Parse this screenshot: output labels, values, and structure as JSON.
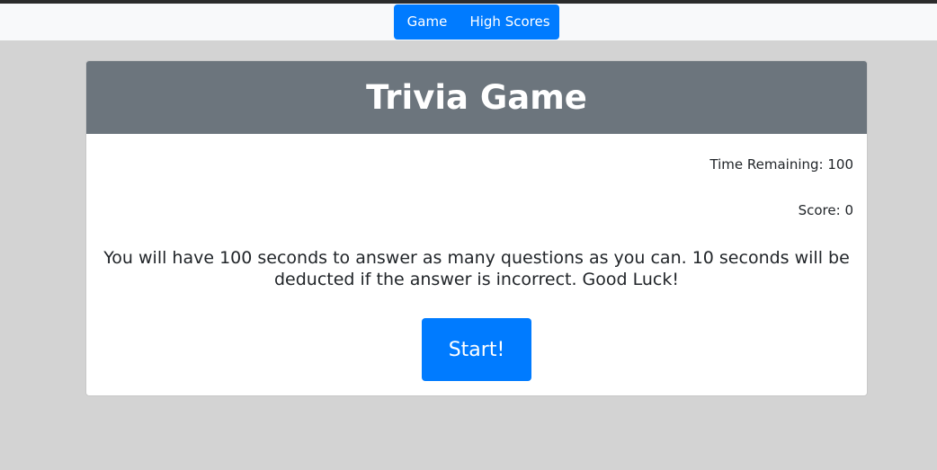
{
  "nav": {
    "game_label": "Game",
    "high_scores_label": "High Scores"
  },
  "card": {
    "title": "Trivia Game",
    "time_remaining": "Time Remaining: 100",
    "score": "Score: 0",
    "instructions": "You will have 100 seconds to answer as many questions as you can. 10 seconds will be deducted if the answer is incorrect. Good Luck!",
    "start_label": "Start!"
  },
  "colors": {
    "background": "#d3d3d3",
    "navbar": "#f8f9fa",
    "primary": "#007bff",
    "header": "#6c757d",
    "text": "#212529"
  }
}
